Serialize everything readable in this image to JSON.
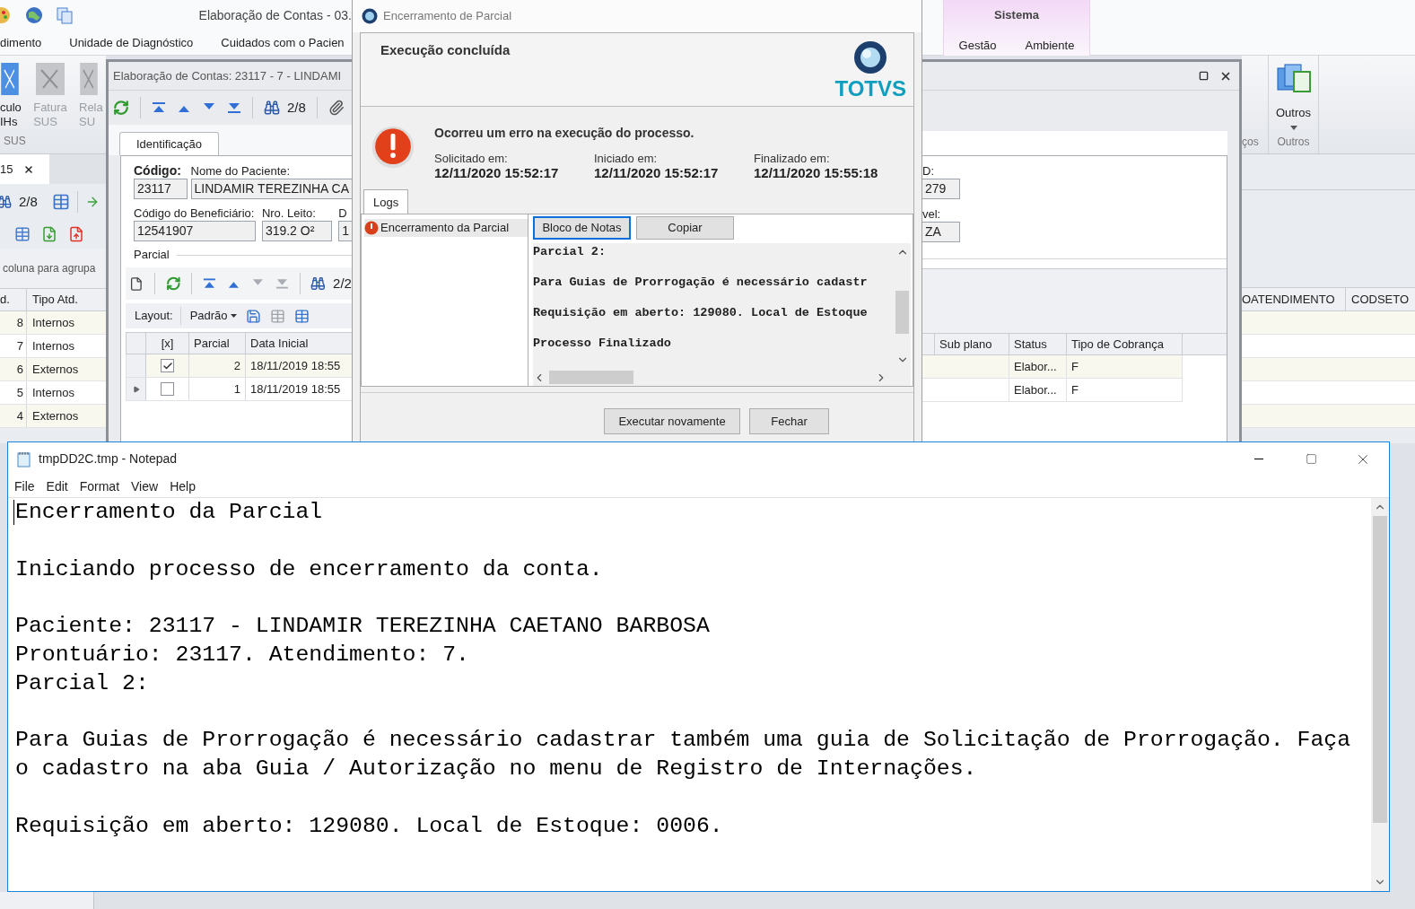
{
  "app": {
    "title": "Elaboração de Contas - 03.",
    "menu_tabs": [
      "dimento",
      "Unidade de Diagnóstico",
      "Cuidados com o Pacien"
    ],
    "context_group": {
      "title": "Sistema",
      "tabs": [
        "Gestão",
        "Ambiente"
      ]
    },
    "ribbon_left": {
      "buttons": [
        {
          "lines": [
            "culo",
            "IHs"
          ],
          "disabled": false
        },
        {
          "lines": [
            "Fatura",
            "SUS"
          ],
          "disabled": true
        },
        {
          "lines": [
            "Rela",
            "SU"
          ],
          "disabled": true
        }
      ],
      "group_label": "SUS"
    },
    "ribbon_right": {
      "cut_group_label": "ços",
      "button": "Outros",
      "group_label": "Outros"
    },
    "document_tab": "15",
    "pager": "2/8",
    "group_hint": "coluna para agrupa",
    "grid_left": {
      "columns": [
        "d.",
        "Tipo Atd."
      ],
      "rows": [
        [
          "8",
          "Internos"
        ],
        [
          "7",
          "Internos"
        ],
        [
          "6",
          "Externos"
        ],
        [
          "5",
          "Internos"
        ],
        [
          "4",
          "Externos"
        ]
      ]
    },
    "grid_right": {
      "columns": [
        "OATENDIMENTO",
        "CODSETO"
      ]
    }
  },
  "record_window": {
    "title": "Elaboração de Contas: 23117 - 7 - LINDAMI",
    "pager": "2/8",
    "tab": "Identificação",
    "fields": [
      {
        "label": "Código:",
        "value": "23117",
        "emphasis": true
      },
      {
        "label": "Nome do Paciente:",
        "value": "LINDAMIR TEREZINHA CA",
        "emphasis": false
      }
    ],
    "fields_row2": [
      {
        "label": "Código do Beneficiário:",
        "value": "12541907",
        "emphasis": false
      },
      {
        "label": "Nro. Leito:",
        "value": "319.2 O²",
        "emphasis": false
      },
      {
        "label": "D",
        "value": "1",
        "emphasis": false
      }
    ],
    "fields_right": [
      {
        "label": "D:",
        "value": "279"
      },
      {
        "label": "vel:",
        "value": "ZA"
      }
    ],
    "parcial": {
      "title": "Parcial",
      "pager": "2/2",
      "layout_label": "Layout:",
      "layout_value": "Padrão",
      "columns": [
        "[x]",
        "Parcial",
        "Data Inicial"
      ],
      "columns_right": [
        "Sub plano",
        "Status",
        "Tipo de Cobrança"
      ],
      "rows": [
        {
          "current": false,
          "checked": true,
          "parcial": "2",
          "data_inicial": "18/11/2019 18:55",
          "status": "Elabor...",
          "tipo_cobranca": "F"
        },
        {
          "current": true,
          "checked": false,
          "parcial": "1",
          "data_inicial": "18/11/2019 18:55",
          "status": "Elabor...",
          "tipo_cobranca": "F"
        }
      ]
    }
  },
  "dialog": {
    "title": "Encerramento de Parcial",
    "heading": "Execução concluída",
    "logo_text": "TOTVS",
    "message": "Ocorreu um erro na execução do processo.",
    "times": [
      {
        "label": "Solicitado em:",
        "value": "12/11/2020 15:52:17"
      },
      {
        "label": "Iniciado em:",
        "value": "12/11/2020 15:52:17"
      },
      {
        "label": "Finalizado em:",
        "value": "12/11/2020 15:55:18"
      }
    ],
    "tabs": [
      {
        "label": "Logs",
        "selected": true
      }
    ],
    "log_items": [
      {
        "label": "Encerramento da Parcial",
        "selected": true
      }
    ],
    "log_buttons": [
      {
        "label": "Bloco de Notas",
        "focused": true
      },
      {
        "label": "Copiar",
        "focused": false
      }
    ],
    "log_lines": [
      "Parcial 2:",
      "Para Guias de Prorrogação é necessário cadastr",
      "Requisição em aberto: 129080. Local de Estoque",
      "Processo Finalizado"
    ],
    "footer_buttons": [
      "Executar novamente",
      "Fechar"
    ]
  },
  "notepad": {
    "title": "tmpDD2C.tmp - Notepad",
    "menu": [
      "File",
      "Edit",
      "Format",
      "View",
      "Help"
    ],
    "paragraphs": [
      [
        "Encerramento da Parcial"
      ],
      [
        "Iniciando processo de encerramento da conta."
      ],
      [
        "Paciente: 23117 - LINDAMIR TEREZINHA CAETANO BARBOSA",
        "Prontuário: 23117. Atendimento: 7.",
        "Parcial 2:"
      ],
      [
        "Para Guias de Prorrogação é necessário cadastrar também uma guia de Solicitação de Prorrogação. Faça",
        "o cadastro na aba Guia / Autorização no menu de Registro de Internações."
      ],
      [
        "Requisição em aberto: 129080. Local de Estoque: 0006."
      ]
    ]
  }
}
